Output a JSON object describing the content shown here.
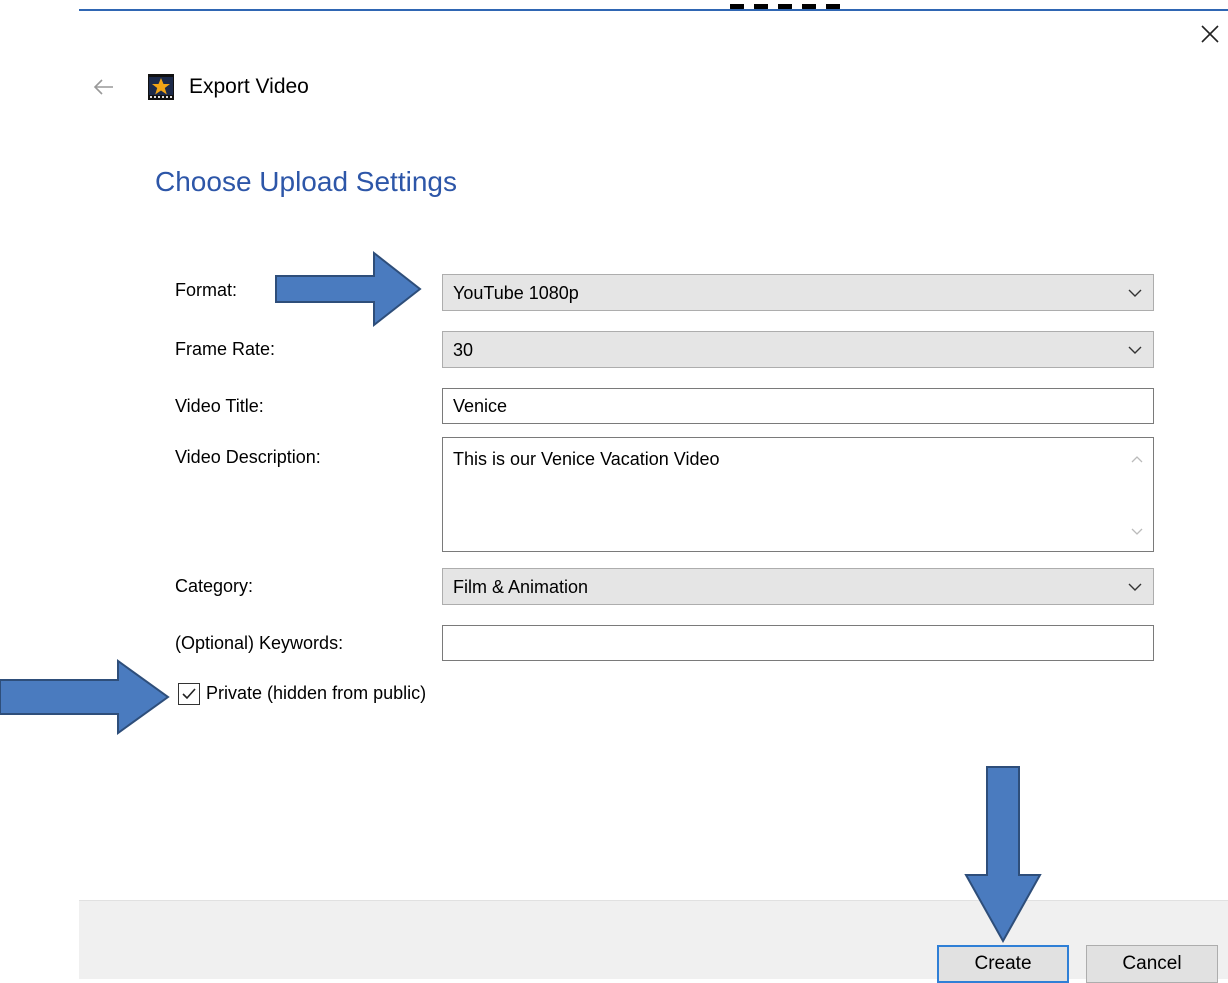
{
  "window": {
    "title": "Export Video",
    "heading": "Choose Upload Settings"
  },
  "form": {
    "format": {
      "label": "Format:",
      "value": "YouTube 1080p"
    },
    "frame_rate": {
      "label": "Frame Rate:",
      "value": "30"
    },
    "video_title": {
      "label": "Video Title:",
      "value": "Venice"
    },
    "video_description": {
      "label": "Video Description:",
      "value": "This is our Venice Vacation Video"
    },
    "category": {
      "label": "Category:",
      "value": "Film & Animation"
    },
    "keywords": {
      "label": "(Optional) Keywords:",
      "value": ""
    },
    "private": {
      "label": "Private (hidden from public)",
      "checked": true
    }
  },
  "footer": {
    "create_label": "Create",
    "cancel_label": "Cancel"
  },
  "icons": {
    "close": "close-icon",
    "back": "back-arrow-icon",
    "app": "star-film-icon",
    "chevron": "chevron-down-icon",
    "check": "checkmark-icon"
  },
  "colors": {
    "heading": "#2d56a8",
    "annotation_arrow_fill": "#4a7bbf",
    "annotation_arrow_stroke": "#2e4e7a",
    "focus_border": "#2f7fd6"
  }
}
